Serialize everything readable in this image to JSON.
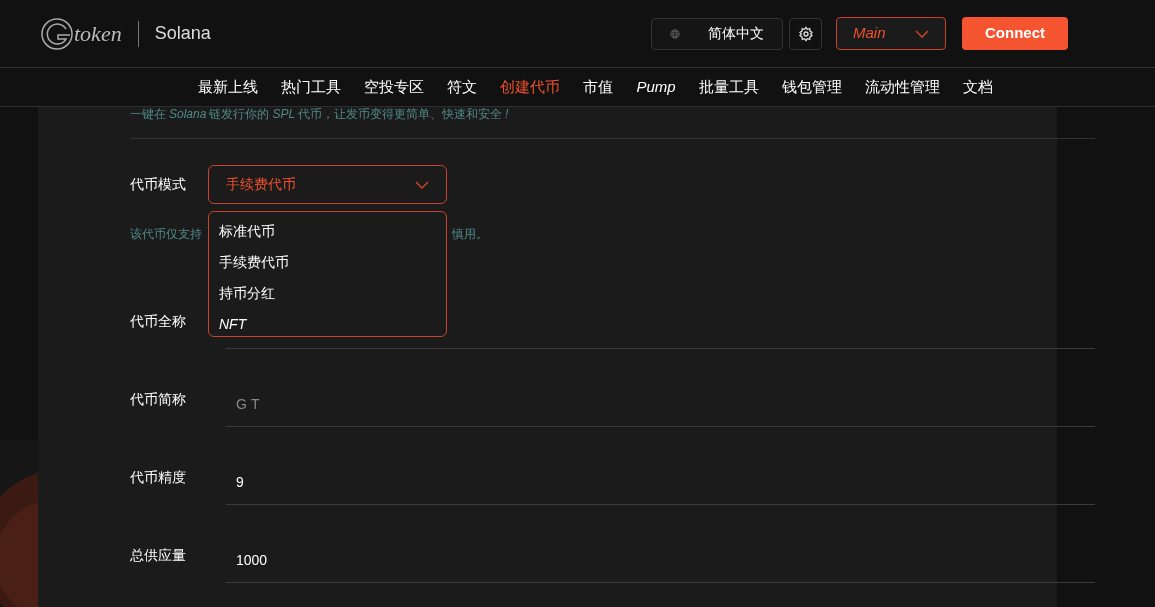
{
  "header": {
    "logo_text": "token",
    "network": "Solana",
    "language": "简体中文",
    "cluster": "Main",
    "connect": "Connect"
  },
  "nav": [
    {
      "label": "最新上线",
      "selected": false
    },
    {
      "label": "热门工具",
      "selected": false
    },
    {
      "label": "空投专区",
      "selected": false
    },
    {
      "label": "符文",
      "selected": false
    },
    {
      "label": "创建代币",
      "selected": true
    },
    {
      "label": "市值",
      "selected": false
    },
    {
      "label": "Pump",
      "selected": false,
      "italic": true
    },
    {
      "label": "批量工具",
      "selected": false
    },
    {
      "label": "钱包管理",
      "selected": false
    },
    {
      "label": "流动性管理",
      "selected": false
    },
    {
      "label": "文档",
      "selected": false
    }
  ],
  "intro": [
    {
      "text": "一键在"
    },
    {
      "text": "Solana",
      "italic": true
    },
    {
      "text": "链发行你的"
    },
    {
      "text": "SPL",
      "italic": true
    },
    {
      "text": "代币，让发币变得更简单、快速和安全"
    },
    {
      "text": "!",
      "italic": true
    }
  ],
  "token_mode": {
    "label": "代币模式",
    "value": "手续费代币",
    "expanded": true,
    "hint_start": "该代币仅支持",
    "hint_end": "慎用。",
    "options": [
      {
        "label": "标准代币"
      },
      {
        "label": "手续费代币"
      },
      {
        "label": "持币分红"
      },
      {
        "label": "NFT",
        "italic": true
      }
    ]
  },
  "fields": [
    {
      "label": "代币全称"
    },
    {
      "label": "代币简称",
      "placeholder": "GT"
    },
    {
      "label": "代币精度",
      "value": "9"
    },
    {
      "label": "总供应量",
      "value": "1000"
    }
  ]
}
